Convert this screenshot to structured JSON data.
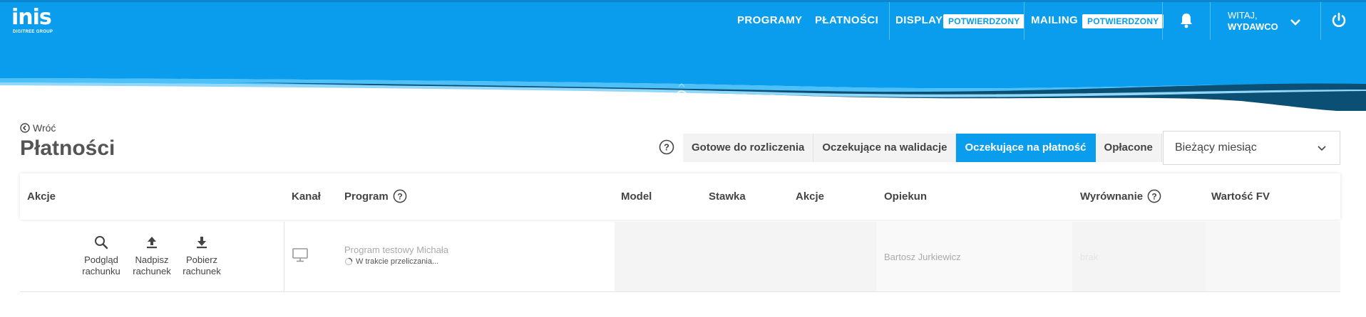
{
  "nav": {
    "logo_text": "inis",
    "logo_subtext": "DIGITREE GROUP",
    "links": [
      "PROGRAMY",
      "PŁATNOŚCI"
    ],
    "display_label": "DISPLAY",
    "display_badge": "POTWIERDZONY",
    "mailing_label": "MAILING",
    "mailing_badge": "POTWIERDZONY",
    "greeting_line1": "WITAJ,",
    "greeting_line2": "WYDAWCO",
    "icons": [
      "bell-icon",
      "chevron-down-icon",
      "power-icon"
    ]
  },
  "header": {
    "back_label": "Wróć",
    "title": "Płatności",
    "filter_tabs": [
      {
        "label": "Gotowe do rozliczenia",
        "active": false
      },
      {
        "label": "Oczekujące na walidacje",
        "active": false
      },
      {
        "label": "Oczekujące na płatność",
        "active": true
      },
      {
        "label": "Opłacone",
        "active": false
      }
    ],
    "period_value": "Bieżący miesiąc"
  },
  "table": {
    "columns": [
      "Akcje",
      "Kanał",
      "Program",
      "Model",
      "Stawka",
      "Akcje",
      "Opiekun",
      "Wyrównanie",
      "Wartość FV"
    ],
    "row": {
      "actions": [
        {
          "line1": "Podgląd",
          "line2": "rachunku",
          "icon": "search-icon"
        },
        {
          "line1": "Nadpisz",
          "line2": "rachunek",
          "icon": "upload-icon"
        },
        {
          "line1": "Pobierz",
          "line2": "rachunek",
          "icon": "download-icon"
        }
      ],
      "channel_icon": "monitor-icon",
      "program_name": "Program testowy Michała",
      "program_status": "W trakcie przeliczania...",
      "opiekun": "Bartosz Jurkiewicz",
      "wyrownanie": "brak"
    }
  },
  "colors": {
    "primary": "#0a9ded",
    "navy": "#0b4f75",
    "light_wave": "#4cc0f7"
  }
}
